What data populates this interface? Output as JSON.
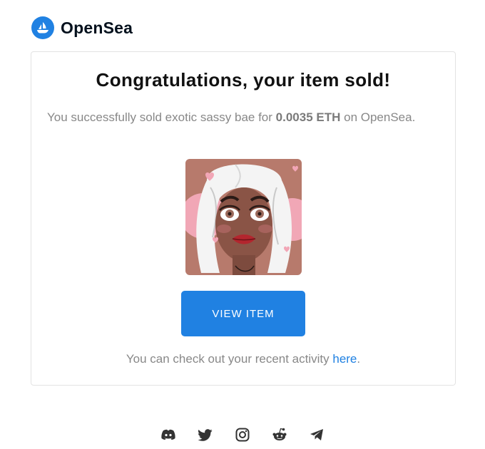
{
  "brand": {
    "name": "OpenSea",
    "accent_color": "#2081e2"
  },
  "card": {
    "title": "Congratulations, your item sold!",
    "message_prefix": "You successfully sold exotic sassy bae for ",
    "price": "0.0035 ETH",
    "message_suffix": " on OpenSea.",
    "image_alt": "exotic sassy bae",
    "button_label": "VIEW ITEM",
    "activity_text": "You can check out your recent activity ",
    "activity_link": "here",
    "activity_end": "."
  },
  "social_icons": [
    "discord-icon",
    "twitter-icon",
    "instagram-icon",
    "reddit-icon",
    "telegram-icon"
  ]
}
